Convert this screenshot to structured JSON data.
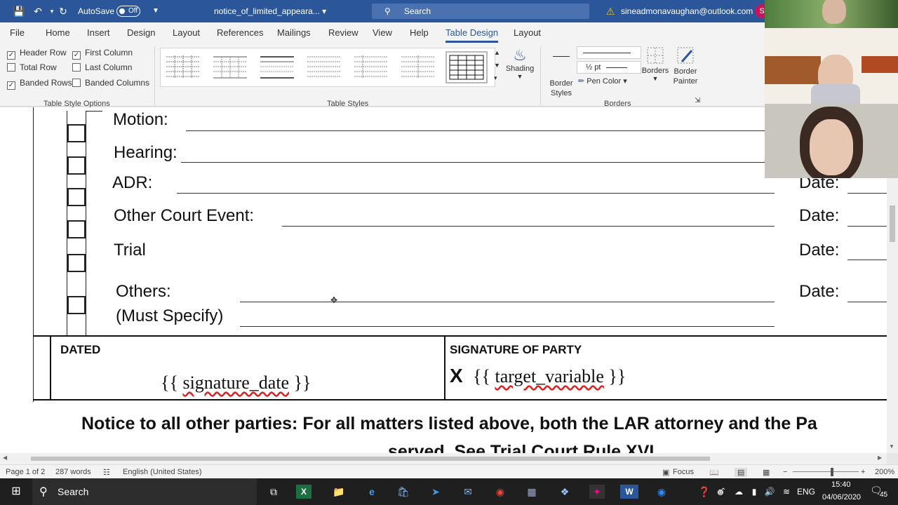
{
  "titlebar": {
    "autosave_label": "AutoSave",
    "autosave_state": "Off",
    "document_title": "notice_of_limited_appeara...",
    "search_placeholder": "Search",
    "account_email": "sineadmonavaughan@outlook.com",
    "avatar_initial": "S"
  },
  "menu": {
    "items": [
      "File",
      "Home",
      "Insert",
      "Design",
      "Layout",
      "References",
      "Mailings",
      "Review",
      "View",
      "Help",
      "Table Design",
      "Layout"
    ],
    "active": "Table Design"
  },
  "ribbon": {
    "style_options": {
      "header_row": "Header Row",
      "first_column": "First Column",
      "total_row": "Total Row",
      "last_column": "Last Column",
      "banded_rows": "Banded Rows",
      "banded_columns": "Banded Columns",
      "group_label": "Table Style Options"
    },
    "table_styles_label": "Table Styles",
    "shading": "Shading",
    "border_styles": "Border Styles",
    "pen_weight": "½ pt",
    "pen_color": "Pen Color",
    "borders": "Borders",
    "border_painter": "Border Painter",
    "borders_group_label": "Borders"
  },
  "document": {
    "rows": [
      {
        "label": "Motion:",
        "date": ""
      },
      {
        "label": "Hearing:",
        "date": ""
      },
      {
        "label": "ADR:",
        "date": "Date:"
      },
      {
        "label": "Other Court Event:",
        "date": "Date:"
      },
      {
        "label": "Trial",
        "date": "Date:"
      },
      {
        "label": "Others:",
        "date": "Date:"
      }
    ],
    "must_specify": "(Must Specify)",
    "dated_header": "DATED",
    "signature_date": "{{ signature_date }}",
    "signature_header": "SIGNATURE OF PARTY",
    "signature_x": "X",
    "target_variable": "{{ target_variable }}",
    "notice_line1": "Notice to all other parties: For all matters listed above, both the LAR attorney and the Pa",
    "notice_line2": "served. See Trial Court Rule XVI"
  },
  "status": {
    "page": "Page 1 of 2",
    "words": "287 words",
    "language": "English (United States)",
    "focus": "Focus",
    "zoom": "200%"
  },
  "taskbar": {
    "search": "Search",
    "lang": "ENG",
    "time": "15:40",
    "date": "04/06/2020",
    "notifications": "45"
  },
  "colors": {
    "word_blue": "#2b579a",
    "taskbar": "#1f1f1f",
    "avatar": "#c2185b"
  }
}
